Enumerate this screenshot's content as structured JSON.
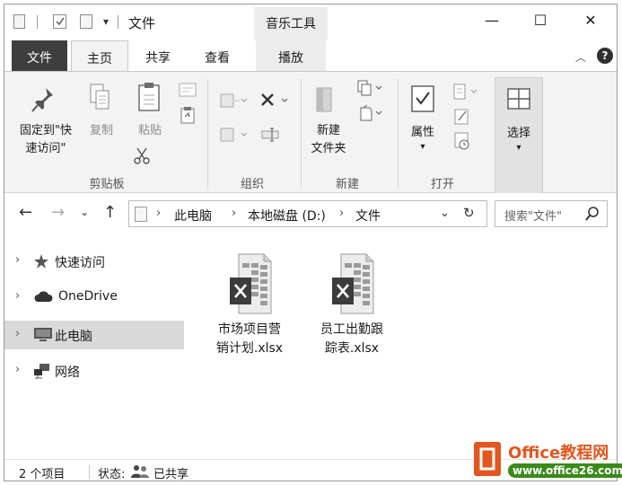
{
  "window": {
    "title": "文件",
    "context_tab_group": "音乐工具",
    "controls": {
      "minimize": "—",
      "maximize": "☐",
      "close": "✕"
    }
  },
  "ribbon_tabs": [
    "文件",
    "主页",
    "共享",
    "查看",
    "播放"
  ],
  "ribbon": {
    "clipboard": {
      "group_label": "剪贴板",
      "pin_label_1": "固定到\"快",
      "pin_label_2": "速访问\"",
      "copy_label": "复制",
      "paste_label": "粘贴"
    },
    "organize": {
      "group_label": "组织"
    },
    "new": {
      "group_label": "新建",
      "new_folder_label_1": "新建",
      "new_folder_label_2": "文件夹"
    },
    "open": {
      "group_label": "打开",
      "properties_label": "属性"
    },
    "select": {
      "label": "选择"
    }
  },
  "address": {
    "breadcrumbs": [
      "此电脑",
      "本地磁盘 (D:)",
      "文件"
    ],
    "search_placeholder": "搜索\"文件\""
  },
  "nav_pane": {
    "items": [
      {
        "label": "快速访问",
        "icon": "star-pin-icon",
        "selected": false
      },
      {
        "label": "OneDrive",
        "icon": "cloud-icon",
        "selected": false
      },
      {
        "label": "此电脑",
        "icon": "computer-icon",
        "selected": true
      },
      {
        "label": "网络",
        "icon": "network-icon",
        "selected": false
      }
    ]
  },
  "files": [
    {
      "name_line1": "市场项目营",
      "name_line2": "销计划.xlsx",
      "icon": "excel-file-icon"
    },
    {
      "name_line1": "员工出勤跟",
      "name_line2": "踪表.xlsx",
      "icon": "excel-file-icon"
    }
  ],
  "status_bar": {
    "item_count": "2 个项目",
    "state_label": "状态:",
    "shared_label": "已共享"
  },
  "watermark": {
    "title": "Office教程网",
    "url": "www.office26.com"
  },
  "colors": {
    "file_tab_bg": "#3e3e3e",
    "ribbon_bg": "#f3f3f3",
    "selected_nav_bg": "#d9d9d9",
    "watermark_orange": "#e2561f",
    "watermark_green": "#3a8a1a"
  }
}
